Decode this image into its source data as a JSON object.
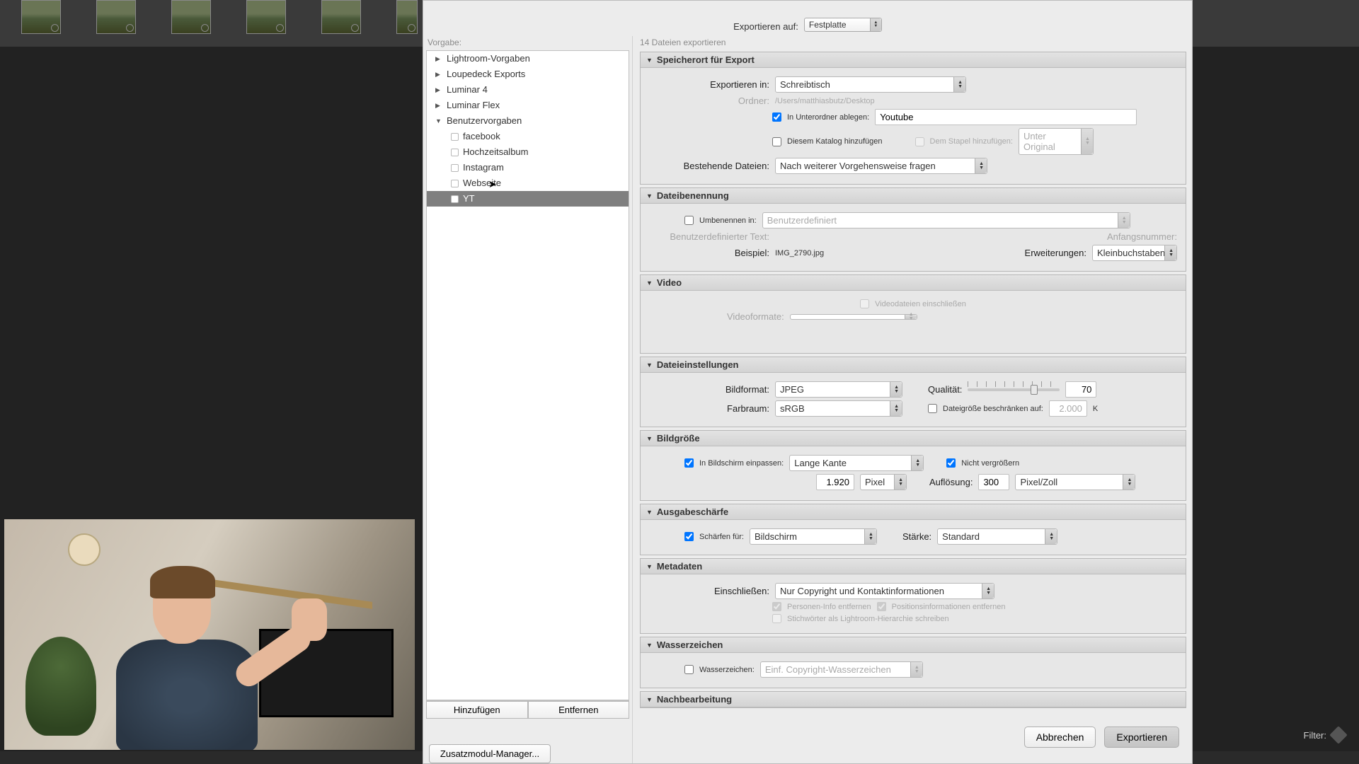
{
  "top": {
    "export_to_label": "Exportieren auf:",
    "export_to_value": "Festplatte"
  },
  "sidebar": {
    "title": "Vorgabe:",
    "groups": [
      {
        "label": "Lightroom-Vorgaben",
        "expanded": false
      },
      {
        "label": "Loupedeck Exports",
        "expanded": false
      },
      {
        "label": "Luminar 4",
        "expanded": false
      },
      {
        "label": "Luminar Flex",
        "expanded": false
      }
    ],
    "user_group": "Benutzervorgaben",
    "user_items": [
      "facebook",
      "Hochzeitsalbum",
      "Instagram",
      "Webseite",
      "YT"
    ],
    "selected_index": 4,
    "add_btn": "Hinzufügen",
    "remove_btn": "Entfernen",
    "plugin_btn": "Zusatzmodul-Manager..."
  },
  "files_count": "14 Dateien exportieren",
  "sections": {
    "location": {
      "title": "Speicherort für Export",
      "export_in_label": "Exportieren in:",
      "export_in_value": "Schreibtisch",
      "folder_label": "Ordner:",
      "folder_value": "/Users/matthiasbutz/Desktop",
      "subfolder_label": "In Unterordner ablegen:",
      "subfolder_value": "Youtube",
      "add_catalog_label": "Diesem Katalog hinzufügen",
      "stack_label": "Dem Stapel hinzufügen:",
      "stack_value": "Unter Original",
      "existing_label": "Bestehende Dateien:",
      "existing_value": "Nach weiterer Vorgehensweise fragen"
    },
    "naming": {
      "title": "Dateibenennung",
      "rename_label": "Umbenennen in:",
      "rename_value": "Benutzerdefiniert",
      "custom_text_label": "Benutzerdefinierter Text:",
      "startnum_label": "Anfangsnummer:",
      "example_label": "Beispiel:",
      "example_value": "IMG_2790.jpg",
      "ext_label": "Erweiterungen:",
      "ext_value": "Kleinbuchstaben"
    },
    "video": {
      "title": "Video",
      "include_label": "Videodateien einschließen",
      "format_label": "Videoformate:"
    },
    "file": {
      "title": "Dateieinstellungen",
      "format_label": "Bildformat:",
      "format_value": "JPEG",
      "quality_label": "Qualität:",
      "quality_value": "70",
      "colorspace_label": "Farbraum:",
      "colorspace_value": "sRGB",
      "limit_label": "Dateigröße beschränken auf:",
      "limit_value": "2.000",
      "limit_unit": "K"
    },
    "size": {
      "title": "Bildgröße",
      "fit_label": "In Bildschirm einpassen:",
      "fit_value": "Lange Kante",
      "noenlarge_label": "Nicht vergrößern",
      "dim_value": "1.920",
      "dim_unit": "Pixel",
      "res_label": "Auflösung:",
      "res_value": "300",
      "res_unit": "Pixel/Zoll"
    },
    "sharpen": {
      "title": "Ausgabeschärfe",
      "for_label": "Schärfen für:",
      "for_value": "Bildschirm",
      "amount_label": "Stärke:",
      "amount_value": "Standard"
    },
    "meta": {
      "title": "Metadaten",
      "include_label": "Einschließen:",
      "include_value": "Nur Copyright und Kontaktinformationen",
      "person_label": "Personen-Info entfernen",
      "position_label": "Positionsinformationen entfernen",
      "keywords_label": "Stichwörter als Lightroom-Hierarchie schreiben"
    },
    "watermark": {
      "title": "Wasserzeichen",
      "wm_label": "Wasserzeichen:",
      "wm_value": "Einf. Copyright-Wasserzeichen"
    },
    "post": {
      "title": "Nachbearbeitung"
    }
  },
  "footer": {
    "cancel": "Abbrechen",
    "export": "Exportieren"
  },
  "filter": {
    "label": "Filter:"
  }
}
